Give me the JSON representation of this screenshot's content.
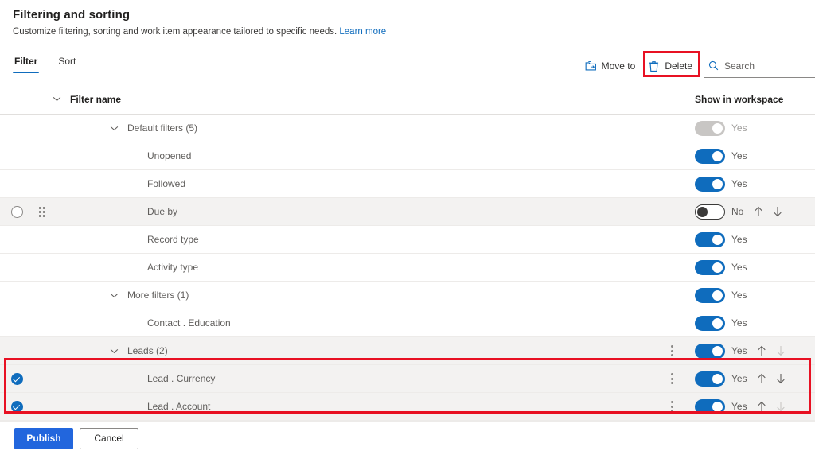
{
  "header": {
    "title": "Filtering and sorting",
    "subtitle": "Customize filtering, sorting and work item appearance tailored to specific needs.",
    "learn_more": "Learn more"
  },
  "tabs": [
    {
      "label": "Filter",
      "active": true
    },
    {
      "label": "Sort",
      "active": false
    }
  ],
  "commands": {
    "move_to": "Move to",
    "move_to_icon": "move-to-folder-icon",
    "delete": "Delete",
    "delete_icon": "trash-icon",
    "search_placeholder": "Search",
    "search_value": "",
    "search_icon": "search-icon"
  },
  "columns": {
    "filter_name": "Filter name",
    "show_in_workspace": "Show in workspace"
  },
  "rows": [
    {
      "name": "Default filters (5)",
      "indent": 1,
      "chevron": true,
      "toggle": "on",
      "toggle_label": "Yes",
      "toggle_disabled": true,
      "checkbox": null,
      "grip": false,
      "kebab": false,
      "arrows": false,
      "shaded": false,
      "selected": false
    },
    {
      "name": "Unopened",
      "indent": 2,
      "chevron": false,
      "toggle": "on",
      "toggle_label": "Yes",
      "toggle_disabled": false,
      "checkbox": null,
      "grip": false,
      "kebab": false,
      "arrows": false,
      "shaded": false,
      "selected": false
    },
    {
      "name": "Followed",
      "indent": 2,
      "chevron": false,
      "toggle": "on",
      "toggle_label": "Yes",
      "toggle_disabled": false,
      "checkbox": null,
      "grip": false,
      "kebab": false,
      "arrows": false,
      "shaded": false,
      "selected": false
    },
    {
      "name": "Due by",
      "indent": 2,
      "chevron": false,
      "toggle": "off",
      "toggle_label": "No",
      "toggle_disabled": false,
      "checkbox": false,
      "grip": true,
      "kebab": false,
      "arrows": true,
      "arrow_up_dim": false,
      "arrow_down_dim": false,
      "shaded": true,
      "selected": false
    },
    {
      "name": "Record type",
      "indent": 2,
      "chevron": false,
      "toggle": "on",
      "toggle_label": "Yes",
      "toggle_disabled": false,
      "checkbox": null,
      "grip": false,
      "kebab": false,
      "arrows": false,
      "shaded": false,
      "selected": false
    },
    {
      "name": "Activity type",
      "indent": 2,
      "chevron": false,
      "toggle": "on",
      "toggle_label": "Yes",
      "toggle_disabled": false,
      "checkbox": null,
      "grip": false,
      "kebab": false,
      "arrows": false,
      "shaded": false,
      "selected": false
    },
    {
      "name": "More filters (1)",
      "indent": 1,
      "chevron": true,
      "toggle": "on",
      "toggle_label": "Yes",
      "toggle_disabled": false,
      "checkbox": null,
      "grip": false,
      "kebab": false,
      "arrows": false,
      "shaded": false,
      "selected": false
    },
    {
      "name": "Contact . Education",
      "indent": 2,
      "chevron": false,
      "toggle": "on",
      "toggle_label": "Yes",
      "toggle_disabled": false,
      "checkbox": null,
      "grip": false,
      "kebab": false,
      "arrows": false,
      "shaded": false,
      "selected": false
    },
    {
      "name": "Leads (2)",
      "indent": 1,
      "chevron": true,
      "toggle": "on",
      "toggle_label": "Yes",
      "toggle_disabled": false,
      "checkbox": null,
      "grip": false,
      "kebab": true,
      "arrows": true,
      "arrow_up_dim": false,
      "arrow_down_dim": true,
      "shaded": true,
      "selected": false
    },
    {
      "name": "Lead . Currency",
      "indent": 2,
      "chevron": false,
      "toggle": "on",
      "toggle_label": "Yes",
      "toggle_disabled": false,
      "checkbox": true,
      "grip": false,
      "kebab": true,
      "arrows": true,
      "arrow_up_dim": false,
      "arrow_down_dim": false,
      "shaded": true,
      "selected": true
    },
    {
      "name": "Lead . Account",
      "indent": 2,
      "chevron": false,
      "toggle": "on",
      "toggle_label": "Yes",
      "toggle_disabled": false,
      "checkbox": true,
      "grip": false,
      "kebab": true,
      "arrows": true,
      "arrow_up_dim": false,
      "arrow_down_dim": true,
      "shaded": true,
      "selected": true
    }
  ],
  "footer": {
    "publish": "Publish",
    "cancel": "Cancel"
  },
  "annotations": {
    "delete_highlight_color": "#e81123",
    "rows_highlight_color": "#e81123"
  }
}
